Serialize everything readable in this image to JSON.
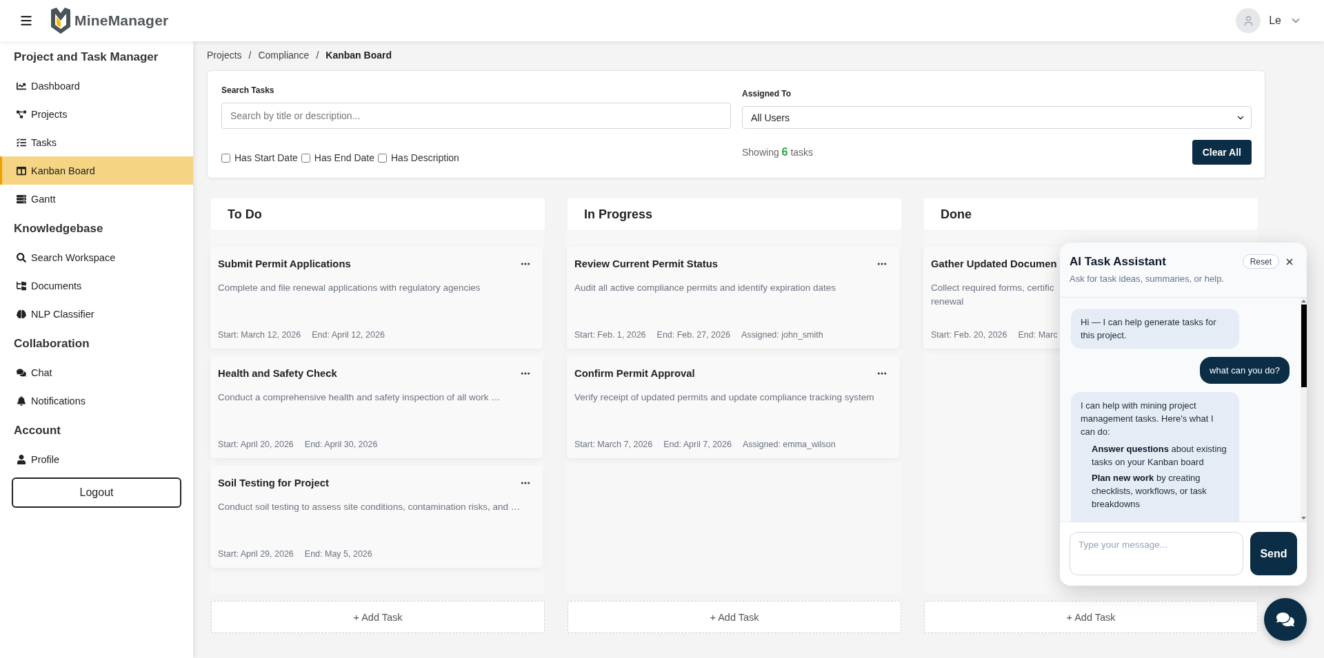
{
  "header": {
    "brand": "MineManager",
    "user": {
      "name": "Le"
    }
  },
  "sidebar": {
    "sections": [
      {
        "title": "Project and Task Manager",
        "items": [
          {
            "label": "Dashboard",
            "selected": false
          },
          {
            "label": "Projects",
            "selected": false
          },
          {
            "label": "Tasks",
            "selected": false
          },
          {
            "label": "Kanban Board",
            "selected": true
          },
          {
            "label": "Gantt",
            "selected": false
          }
        ]
      },
      {
        "title": "Knowledgebase",
        "items": [
          {
            "label": "Search Workspace",
            "selected": false
          },
          {
            "label": "Documents",
            "selected": false
          },
          {
            "label": "NLP Classifier",
            "selected": false
          }
        ]
      },
      {
        "title": "Collaboration",
        "items": [
          {
            "label": "Chat",
            "selected": false
          },
          {
            "label": "Notifications",
            "selected": false
          }
        ]
      },
      {
        "title": "Account",
        "items": [
          {
            "label": "Profile",
            "selected": false
          }
        ]
      }
    ],
    "logout_button": "Logout"
  },
  "breadcrumb": [
    {
      "kind": "link",
      "text": "Projects"
    },
    {
      "kind": "separator",
      "text": "/"
    },
    {
      "kind": "link",
      "text": "Compliance"
    },
    {
      "kind": "separator",
      "text": "/"
    },
    {
      "kind": "current",
      "text": "Kanban Board"
    }
  ],
  "filters": {
    "search": {
      "label": "Search Tasks",
      "placeholder": "Search by title or description..."
    },
    "assigned_to": {
      "label": "Assigned To",
      "value": "All Users"
    },
    "checkboxes": [
      {
        "label": "Has Start Date",
        "checked": false
      },
      {
        "label": "Has End Date",
        "checked": false
      },
      {
        "label": "Has Description",
        "checked": false
      }
    ],
    "summary": {
      "before": "Showing",
      "count": "6",
      "after": "tasks"
    },
    "clear_button": "Clear All"
  },
  "board": {
    "columns": [
      {
        "title": "To Do",
        "tasks": [
          {
            "title": "Submit Permit Applications",
            "description": "Complete and file renewal applications with regulatory agencies",
            "meta": [
              "Start: March 12, 2026",
              "End: April 12, 2026"
            ],
            "menu": true
          },
          {
            "title": "Health and Safety Check",
            "description": "Conduct a comprehensive health and safety inspection of all work …",
            "meta": [
              "Start: April 20, 2026",
              "End: April 30, 2026"
            ],
            "menu": true
          },
          {
            "title": "Soil Testing for Project",
            "description": "Conduct soil testing to assess site conditions, contamination risks, and …",
            "meta": [
              "Start: April 29, 2026",
              "End: May 5, 2026"
            ],
            "menu": true
          }
        ],
        "add_button": "+ Add Task"
      },
      {
        "title": "In Progress",
        "tasks": [
          {
            "title": "Review Current Permit Status",
            "description": "Audit all active compliance permits and identify expiration dates",
            "meta": [
              "Start: Feb. 1, 2026",
              "End: Feb. 27, 2026",
              "Assigned: john_smith"
            ],
            "menu": true
          },
          {
            "title": "Confirm Permit Approval",
            "description": "Verify receipt of updated permits and update compliance tracking system",
            "meta": [
              "Start: March 7, 2026",
              "End: April 7, 2026",
              "Assigned: emma_wilson"
            ],
            "menu": true
          }
        ],
        "add_button": "+ Add Task"
      },
      {
        "title": "Done",
        "tasks": [
          {
            "title": "Gather Updated Documen",
            "description": "Collect required forms, certific\nrenewal",
            "meta": [
              "Start: Feb. 20, 2026",
              "End: Marc"
            ],
            "menu": false
          }
        ],
        "add_button": "+ Add Task"
      }
    ]
  },
  "assistant": {
    "title": "AI Task Assistant",
    "subtitle": "Ask for task ideas, summaries, or help.",
    "reset_button": "Reset",
    "messages": [
      {
        "kind": "bot",
        "text": "Hi — I can help generate tasks for this project."
      },
      {
        "kind": "user",
        "text": "what can you do?"
      },
      {
        "kind": "bot",
        "text": "I can help with mining project management tasks. Here's what I can do:",
        "list": [
          "**Answer questions** about existing tasks on your Kanban board",
          "**Plan new work** by creating checklists, workflows, or task breakdowns"
        ]
      }
    ],
    "input": {
      "placeholder": "Type your message..."
    },
    "send_button": "Send"
  }
}
